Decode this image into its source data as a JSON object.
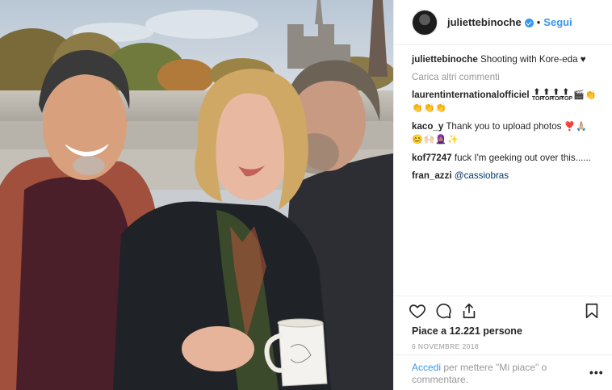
{
  "header": {
    "username": "juliettebinoche",
    "separator": "•",
    "follow_label": "Segui"
  },
  "comments": {
    "caption": {
      "user": "juliettebinoche",
      "text": "Shooting with Kore-eda ♥"
    },
    "load_more_label": "Carica altri commenti",
    "items": [
      {
        "user": "laurentinternationalofficiel",
        "text": "",
        "emoji": "🎬👏👏👏👏",
        "top_label": "TOP"
      },
      {
        "user": "kaco_y",
        "text": "Thank you to upload photos",
        "emoji": "❣️🙏🏼",
        "emoji2": "😊🙌🏻🧕🏽✨"
      },
      {
        "user": "kof77247",
        "text": "fuck I'm geeking out over this......"
      },
      {
        "user": "fran_azzi",
        "text": "@cassiobras"
      }
    ]
  },
  "footer": {
    "likes": "Piace a 12.221 persone",
    "date": "6 novembre 2018",
    "login_link": "Accedi",
    "login_text": " per mettere \"Mi piace\" o commentare.",
    "options_label": "•••"
  },
  "icons": {
    "like": "heart-icon",
    "comment": "comment-icon",
    "share": "share-icon",
    "save": "bookmark-icon",
    "options": "more-options-icon",
    "verified": "verified-badge-icon"
  },
  "colors": {
    "accent": "#3897f0",
    "text": "#262626",
    "muted": "#999999",
    "border": "#efefef"
  }
}
